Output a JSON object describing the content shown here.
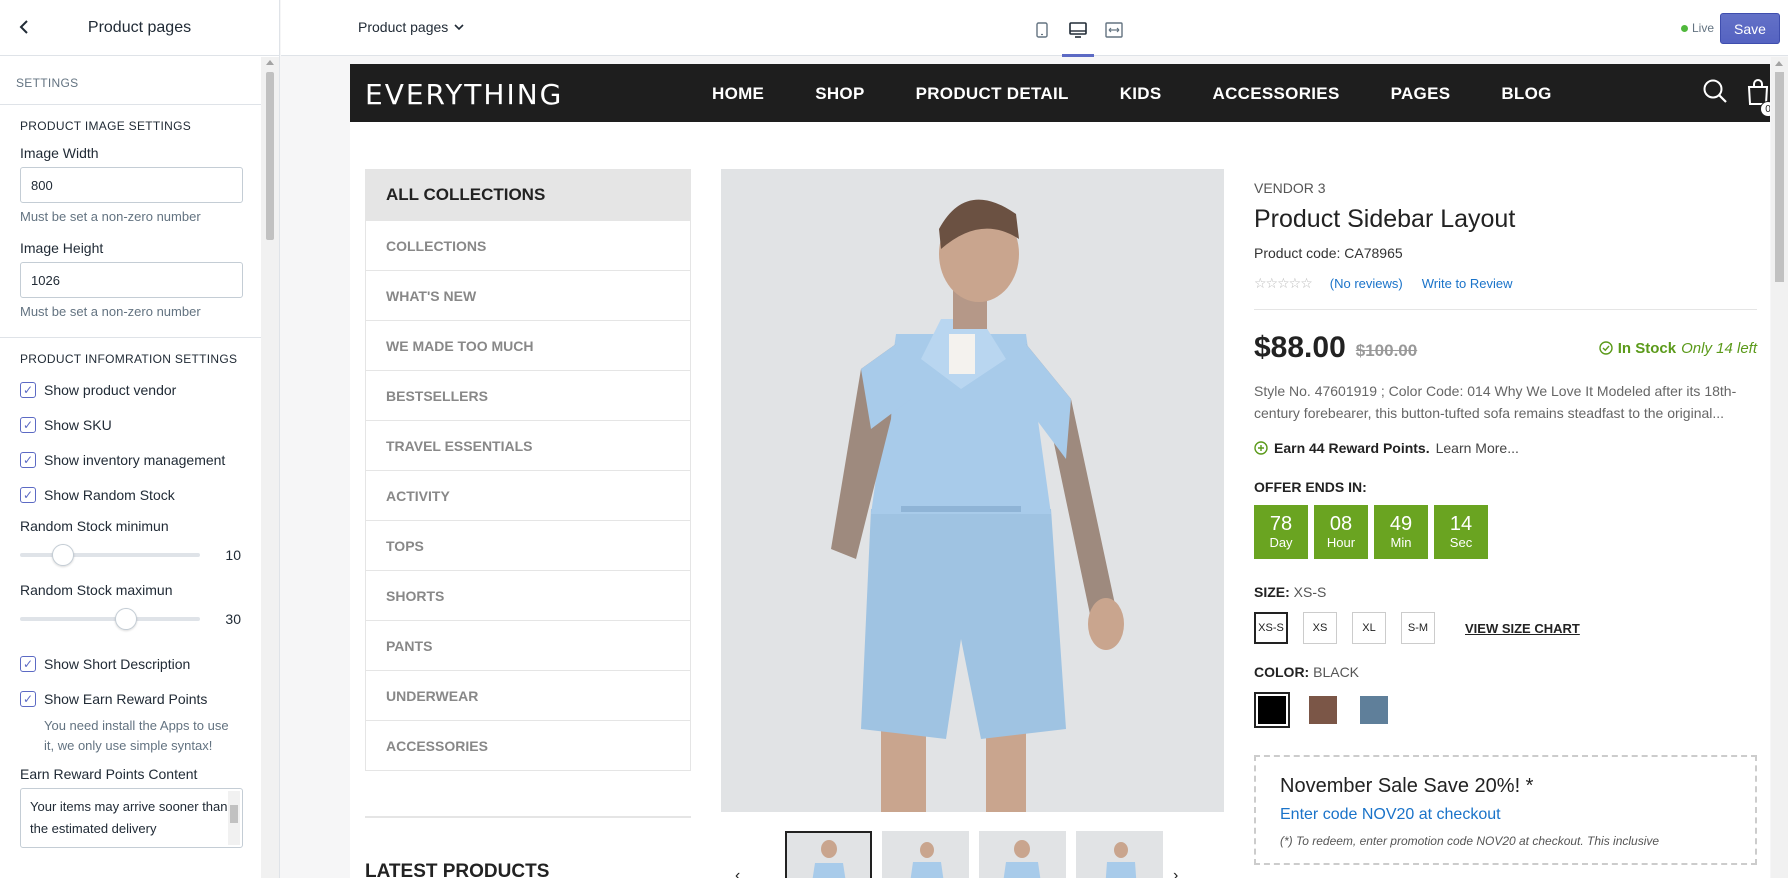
{
  "panel": {
    "title": "Product pages",
    "section_label": "SETTINGS",
    "image_group": {
      "title": "PRODUCT IMAGE SETTINGS",
      "width_label": "Image Width",
      "width_value": "800",
      "width_help": "Must be set a non-zero number",
      "height_label": "Image Height",
      "height_value": "1026",
      "height_help": "Must be set a non-zero number"
    },
    "info_group": {
      "title": "PRODUCT INFOMRATION SETTINGS",
      "checks": [
        {
          "label": "Show product vendor",
          "checked": true
        },
        {
          "label": "Show SKU",
          "checked": true
        },
        {
          "label": "Show inventory management",
          "checked": true
        },
        {
          "label": "Show Random Stock",
          "checked": true
        }
      ],
      "range_min": {
        "label": "Random Stock minimun",
        "value": "10",
        "fraction": 0.2
      },
      "range_max": {
        "label": "Random Stock maximun",
        "value": "30",
        "fraction": 0.6
      },
      "checks2": [
        {
          "label": "Show Short Description",
          "checked": true
        },
        {
          "label": "Show Earn Reward Points",
          "checked": true
        }
      ],
      "reward_help": "You need install the Apps to use it, we only use simple syntax!",
      "reward_content_label": "Earn Reward Points Content",
      "reward_content_value": "Your items may arrive sooner than the estimated delivery"
    }
  },
  "toolbar": {
    "page_select": "Product pages",
    "devices": [
      "mobile-icon",
      "desktop-icon",
      "fullwidth-icon"
    ],
    "active_device": "desktop-icon",
    "live_label": "Live",
    "save_label": "Save",
    "accent": "#5c6ac4"
  },
  "store": {
    "logo": "EVERYTHING",
    "nav": [
      "HOME",
      "SHOP",
      "PRODUCT DETAIL",
      "KIDS",
      "ACCESSORIES",
      "PAGES",
      "BLOG"
    ],
    "cart_count": "0",
    "collections_head": "ALL COLLECTIONS",
    "collections": [
      "COLLECTIONS",
      "WHAT'S NEW",
      "WE MADE TOO MUCH",
      "BESTSELLERS",
      "TRAVEL ESSENTIALS",
      "ACTIVITY",
      "TOPS",
      "SHORTS",
      "PANTS",
      "UNDERWEAR",
      "ACCESSORIES"
    ],
    "latest_title": "LATEST PRODUCTS"
  },
  "product": {
    "vendor": "VENDOR 3",
    "title": "Product Sidebar Layout",
    "code": "Product code: CA78965",
    "stars": "☆☆☆☆☆",
    "reviews_link": "(No reviews)",
    "write_review": "Write to Review",
    "price": "$88.00",
    "old_price": "$100.00",
    "stock_label": "In Stock",
    "stock_left": "Only 14 left",
    "description": "Style No. 47601919 ; Color Code: 014 Why We Love It Modeled after its 18th-century forebearer, this button-tufted sofa remains steadfast to the original...",
    "reward_text": "Earn 44 Reward Points.",
    "reward_learn": "Learn More...",
    "offer_label": "OFFER ENDS IN:",
    "countdown": [
      {
        "num": "78",
        "label": "Day"
      },
      {
        "num": "08",
        "label": "Hour"
      },
      {
        "num": "49",
        "label": "Min"
      },
      {
        "num": "14",
        "label": "Sec"
      }
    ],
    "size_label": "SIZE:",
    "size_value": "XS-S",
    "sizes": [
      "XS-S",
      "XS",
      "XL",
      "S-M"
    ],
    "size_chart": "VIEW SIZE CHART",
    "color_label": "COLOR:",
    "color_value": "BLACK",
    "colors": [
      "#000000",
      "#7b5647",
      "#5f7f9a"
    ],
    "promo_title": "November Sale Save 20%! *",
    "promo_code": "Enter code NOV20 at checkout",
    "promo_note": "(*) To redeem, enter promotion code NOV20 at checkout. This inclusive",
    "stock_color": "#5b9a1a",
    "countdown_color": "#6aa421"
  }
}
